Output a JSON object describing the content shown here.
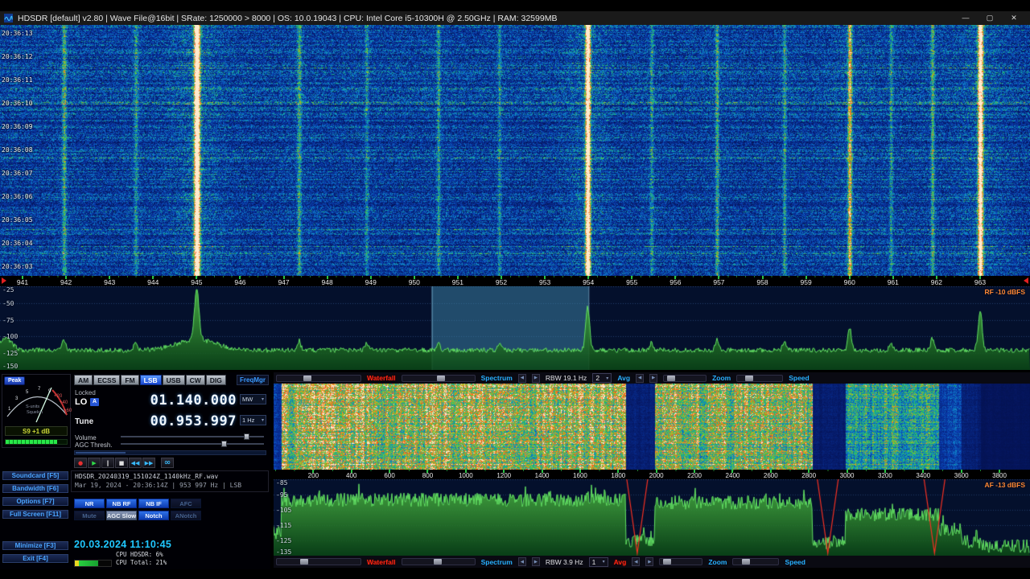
{
  "titlebar": {
    "title": "HDSDR  [default]  v2.80   |   Wave File@16bit   |   SRate: 1250000 > 8000   |   OS: 10.0.19043   |   CPU: Intel Core i5-10300H @ 2.50GHz   |   RAM: 32599MB",
    "minimize": "—",
    "maximize": "▢",
    "close": "✕"
  },
  "rf_waterfall": {
    "timestamps": [
      "20:36:13",
      "20:36:12",
      "20:36:11",
      "20:36:10",
      "20:36:09",
      "20:36:08",
      "20:36:07",
      "20:36:06",
      "20:36:05",
      "20:36:04",
      "20:36:03"
    ]
  },
  "rf_ruler": {
    "ticks": [
      "941",
      "942",
      "943",
      "944",
      "945",
      "946",
      "947",
      "948",
      "949",
      "950",
      "951",
      "952",
      "953",
      "954",
      "955",
      "956",
      "957",
      "958",
      "959",
      "960",
      "961",
      "962",
      "963"
    ]
  },
  "rf_spectrum": {
    "db_labels": [
      -25,
      -50,
      -75,
      -100,
      -125,
      -150
    ],
    "dbfs_label": "RF -10 dBFS"
  },
  "receiver": {
    "modes": [
      {
        "label": "AM",
        "active": false
      },
      {
        "label": "ECSS",
        "active": false
      },
      {
        "label": "FM",
        "active": false
      },
      {
        "label": "LSB",
        "active": true
      },
      {
        "label": "USB",
        "active": false
      },
      {
        "label": "CW",
        "active": false
      },
      {
        "label": "DIG",
        "active": false
      }
    ],
    "freqmgr_label": "FreqMgr",
    "locked_label": "Locked",
    "lo_label": "LO",
    "lo_badge": "A",
    "lo_frequency": "01.140.000",
    "lo_band": "MW",
    "tune_label": "Tune",
    "tune_frequency": "00.953.997",
    "tune_step": "1 Hz",
    "volume_label": "Volume",
    "agc_label": "AGC Thresh.",
    "smeter": {
      "peak_label": "Peak",
      "scale_labels": [
        "1",
        "3",
        "5",
        "7",
        "9",
        "+20",
        "+40",
        "+60"
      ],
      "units_label": "S-units",
      "squelch_label": "Squelch",
      "reading": "S9 +1 dB"
    },
    "playback": [
      {
        "name": "record-button",
        "glyph": "●",
        "color": "#e83030"
      },
      {
        "name": "play-button",
        "glyph": "▶",
        "color": "#30d848"
      },
      {
        "name": "pause-button",
        "glyph": "‖",
        "color": "#d8d8d8"
      },
      {
        "name": "stop-button",
        "glyph": "■",
        "color": "#e0e0e0"
      },
      {
        "name": "rewind-button",
        "glyph": "◀◀",
        "color": "#38b8f8"
      },
      {
        "name": "forward-button",
        "glyph": "▶▶",
        "color": "#38b8f8"
      },
      {
        "name": "loop-button",
        "glyph": "∞",
        "color": "#38b8f8"
      }
    ],
    "file_name": "HDSDR_20240319_151024Z_1140kHz_RF.wav",
    "file_status": "Mar 19, 2024 - 20:36:14Z | 953 997 Hz | LSB",
    "dsp_buttons": [
      {
        "label": "NR",
        "state": "on"
      },
      {
        "label": "NB RF",
        "state": "on"
      },
      {
        "label": "NB IF",
        "state": "on"
      },
      {
        "label": "AFC",
        "state": "off"
      },
      {
        "label": "Mute",
        "state": "off"
      },
      {
        "label": "AGC Slow",
        "state": "mid"
      },
      {
        "label": "Notch",
        "state": "on"
      },
      {
        "label": "ANotch",
        "state": "off"
      }
    ],
    "nav_buttons": [
      "Soundcard  [F5]",
      "Bandwidth  [F6]",
      "Options  [F7]",
      "Full Screen  [F11]"
    ],
    "sys_buttons": [
      "Minimize  [F3]",
      "Exit  [F4]"
    ],
    "datetime": "20.03.2024 11:10:45",
    "cpu_hdsdr": "CPU HDSDR:  6%",
    "cpu_total": "CPU Total: 21%"
  },
  "af_panel": {
    "top_bar": {
      "waterfall_label": "Waterfall",
      "spectrum_label": "Spectrum",
      "rbw": "RBW 19.1 Hz",
      "avg_value": "2",
      "avg_label": "Avg",
      "zoom_label": "Zoom",
      "speed_label": "Speed"
    },
    "bottom_bar": {
      "waterfall_label": "Waterfall",
      "spectrum_label": "Spectrum",
      "rbw": "RBW  3.9 Hz",
      "avg_value": "1",
      "avg_label": "Avg",
      "zoom_label": "Zoom",
      "speed_label": "Speed"
    },
    "ruler_ticks": [
      "200",
      "400",
      "600",
      "800",
      "1000",
      "1200",
      "1400",
      "1600",
      "1800",
      "2000",
      "2200",
      "2400",
      "2600",
      "2800",
      "3000",
      "3200",
      "3400",
      "3600",
      "3800"
    ],
    "spectrum": {
      "db_labels": [
        -85,
        -95,
        -105,
        -115,
        -125,
        -135
      ],
      "dbfs_label": "AF -13 dBFS"
    }
  }
}
